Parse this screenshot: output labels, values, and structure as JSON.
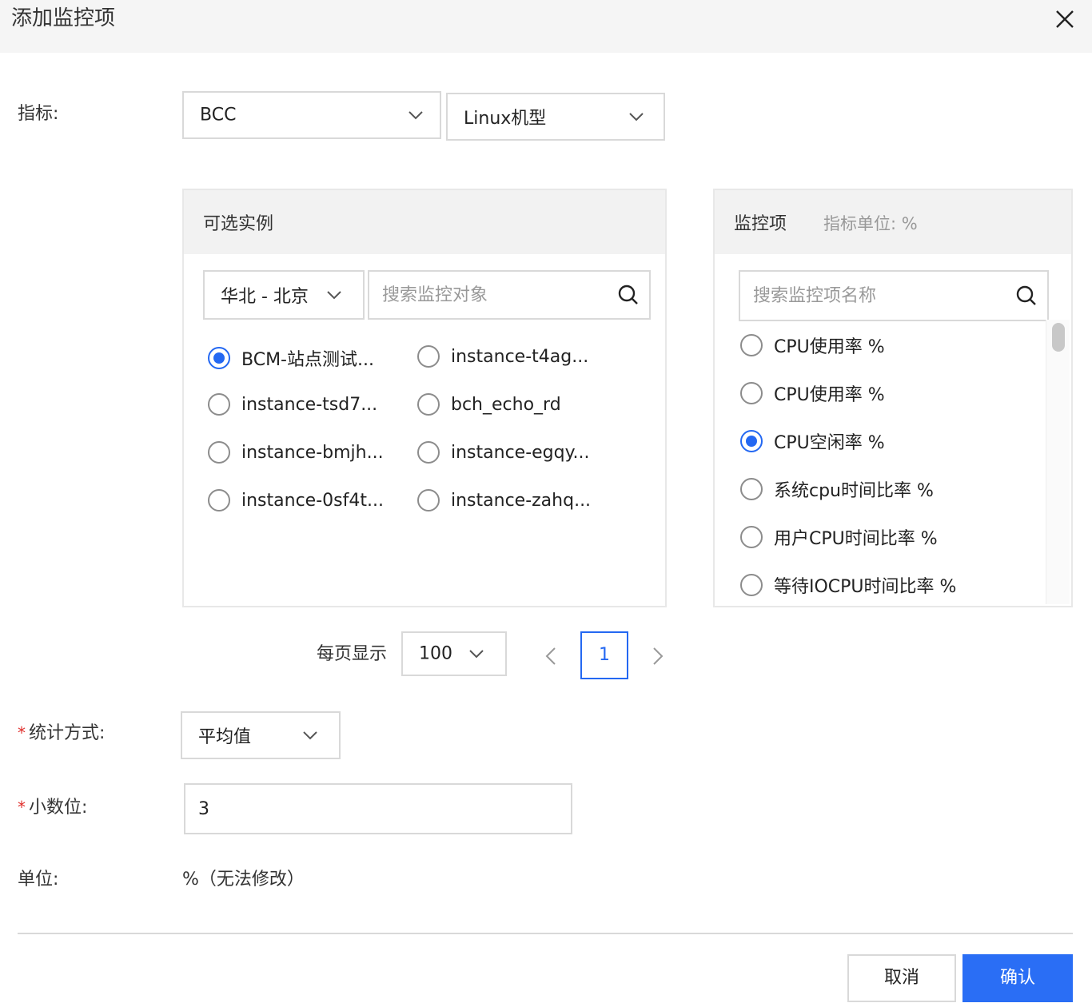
{
  "dialog": {
    "title": "添加监控项"
  },
  "form": {
    "metric_label": "指标:",
    "metric_service": "BCC",
    "metric_type": "Linux机型",
    "stat_label": "统计方式:",
    "stat_value": "平均值",
    "decimal_label": "小数位:",
    "decimal_value": "3",
    "unit_label": "单位:",
    "unit_value": "%（无法修改）"
  },
  "instances": {
    "title": "可选实例",
    "region": "华北 - 北京",
    "search_placeholder": "搜索监控对象",
    "items": [
      {
        "label": "BCM-站点测试...",
        "selected": true
      },
      {
        "label": "instance-t4ag...",
        "selected": false
      },
      {
        "label": "instance-tsd7...",
        "selected": false
      },
      {
        "label": "bch_echo_rd",
        "selected": false
      },
      {
        "label": "instance-bmjh...",
        "selected": false
      },
      {
        "label": "instance-egqy...",
        "selected": false
      },
      {
        "label": "instance-0sf4t...",
        "selected": false
      },
      {
        "label": "instance-zahq...",
        "selected": false
      }
    ]
  },
  "metrics": {
    "title": "监控项",
    "unit_hint": "指标单位: %",
    "search_placeholder": "搜索监控项名称",
    "items": [
      {
        "label": "CPU使用率 %",
        "selected": false
      },
      {
        "label": "CPU使用率 %",
        "selected": false
      },
      {
        "label": "CPU空闲率 %",
        "selected": true
      },
      {
        "label": "系统cpu时间比率 %",
        "selected": false
      },
      {
        "label": "用户CPU时间比率 %",
        "selected": false
      },
      {
        "label": "等待IOCPU时间比率 %",
        "selected": false
      }
    ]
  },
  "pagination": {
    "per_page_label": "每页显示",
    "per_page_value": "100",
    "current_page": "1"
  },
  "buttons": {
    "cancel": "取消",
    "confirm": "确认"
  },
  "colors": {
    "accent": "#2468f2",
    "primary_button": "#2a6ef5",
    "required": "#e0302d"
  }
}
